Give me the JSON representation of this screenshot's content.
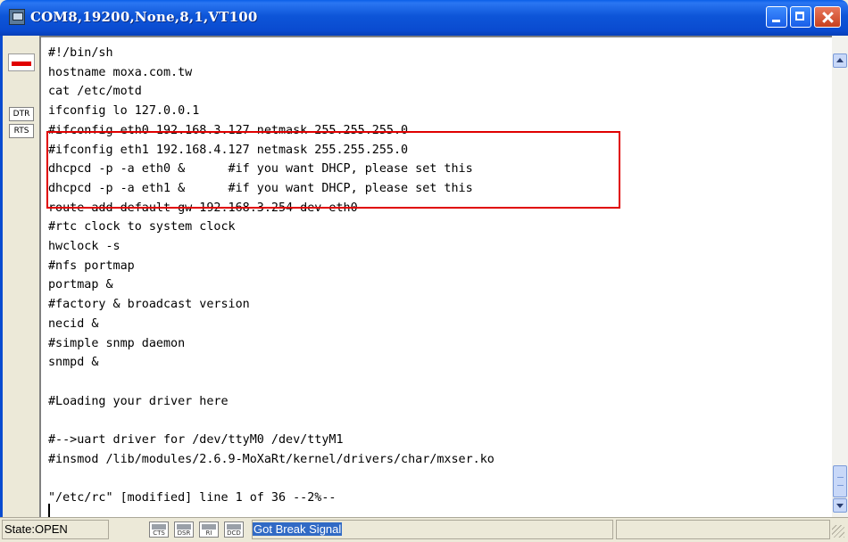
{
  "window": {
    "title": "COM8,19200,None,8,1,VT100"
  },
  "left_panel": {
    "dtr_label": "DTR",
    "rts_label": "RTS"
  },
  "terminal": {
    "lines": [
      "#!/bin/sh",
      "hostname moxa.com.tw",
      "cat /etc/motd",
      "ifconfig lo 127.0.0.1",
      "#ifconfig eth0 192.168.3.127 netmask 255.255.255.0",
      "#ifconfig eth1 192.168.4.127 netmask 255.255.255.0",
      "dhcpcd -p -a eth0 &      #if you want DHCP, please set this",
      "dhcpcd -p -a eth1 &      #if you want DHCP, please set this",
      "route add default gw 192.168.3.254 dev eth0",
      "#rtc clock to system clock",
      "hwclock -s",
      "#nfs portmap",
      "portmap &",
      "#factory & broadcast version",
      "necid &",
      "#simple snmp daemon",
      "snmpd &",
      "",
      "#Loading your driver here",
      "",
      "#-->uart driver for /dev/ttyM0 /dev/ttyM1",
      "#insmod /lib/modules/2.6.9-MoXaRt/kernel/drivers/char/mxser.ko",
      "",
      "\"/etc/rc\" [modified] line 1 of 36 --2%--"
    ]
  },
  "statusbar": {
    "state": "State:OPEN",
    "signals": [
      "CTS",
      "DSR",
      "RI",
      "DCD"
    ],
    "message": "Got Break Signal"
  }
}
